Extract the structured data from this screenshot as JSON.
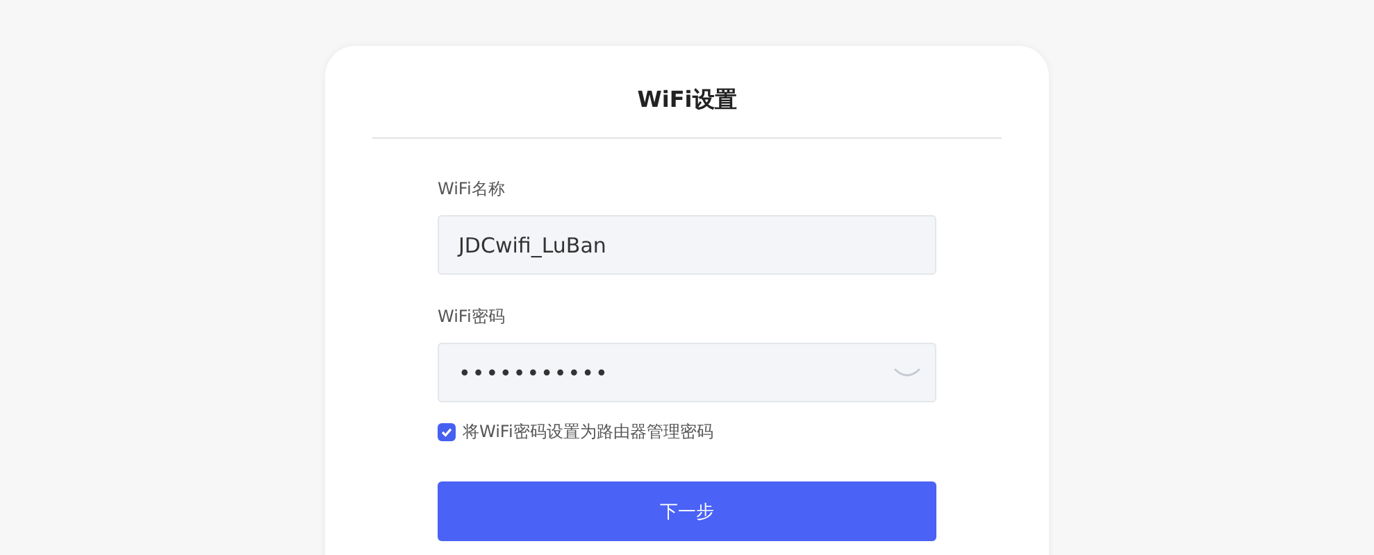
{
  "card": {
    "title": "WiFi设置"
  },
  "fields": [
    {
      "kind": "text",
      "label": "WiFi名称",
      "value": "JDCwifi_LuBan"
    },
    {
      "kind": "password",
      "label": "WiFi密码",
      "value": "•••••••••••"
    }
  ],
  "option": {
    "label": "将WiFi密码设置为路由器管理密码",
    "checked": true
  },
  "button": {
    "label": "下一步"
  }
}
